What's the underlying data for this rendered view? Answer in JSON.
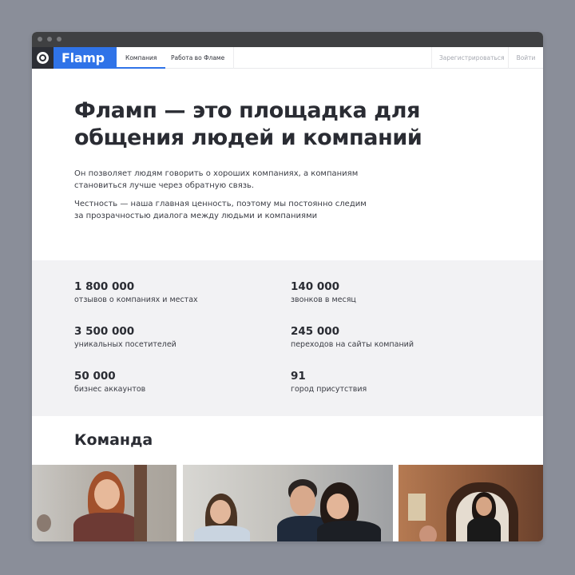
{
  "nav": {
    "logo": "Flamp",
    "company_tab": "Компания",
    "careers_tab": "Работа во Фламе",
    "register": "Зарегистрироваться",
    "login": "Войти"
  },
  "hero": {
    "title": "Фламп — это площадка для общения людей и компаний",
    "paragraph1": "Он позволяет людям говорить о хороших компаниях, а компаниям становиться лучше через обратную связь.",
    "paragraph2": "Честность — наша главная ценность, поэтому мы постоянно следим за прозрачностью диалога между людьми и компаниями"
  },
  "stats": [
    {
      "value": "1 800 000",
      "label": "отзывов о компаниях и местах"
    },
    {
      "value": "140 000",
      "label": "звонков в месяц"
    },
    {
      "value": "3 500 000",
      "label": "уникальных посетителей"
    },
    {
      "value": "245 000",
      "label": "переходов на сайты компаний"
    },
    {
      "value": "50 000",
      "label": "бизнес аккаунтов"
    },
    {
      "value": "91",
      "label": "город присутствия"
    }
  ],
  "team": {
    "title": "Команда"
  },
  "colors": {
    "brand_blue": "#2f73e8",
    "dark": "#2a2c33",
    "stats_bg": "#f2f2f4"
  }
}
